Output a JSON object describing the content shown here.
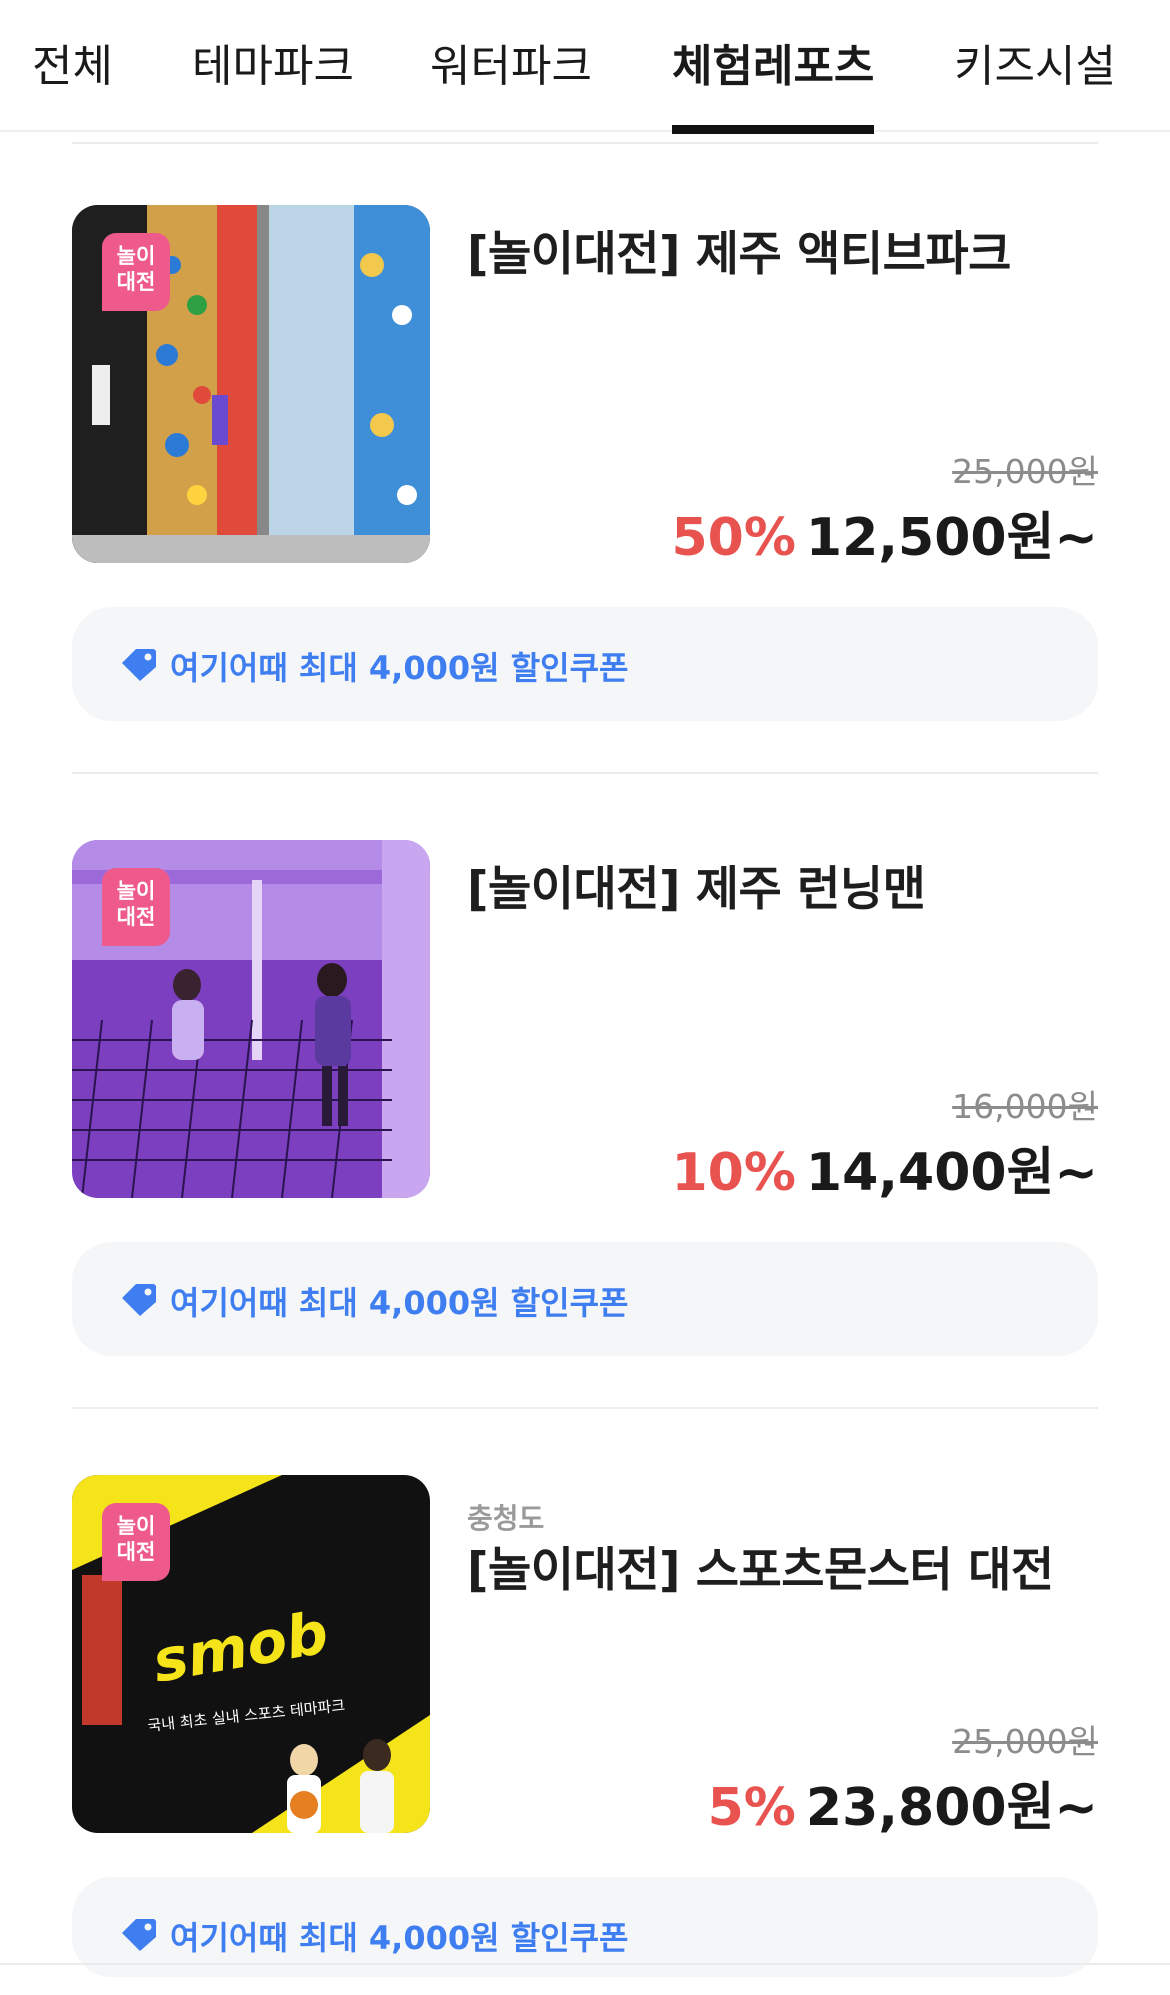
{
  "tabs": [
    {
      "label": "전체",
      "active": false
    },
    {
      "label": "테마파크",
      "active": false
    },
    {
      "label": "워터파크",
      "active": false
    },
    {
      "label": "체험레포츠",
      "active": true
    },
    {
      "label": "키즈시설",
      "active": false
    }
  ],
  "products": [
    {
      "badge": "놀이\n대전",
      "region": "",
      "title": "[놀이대전] 제주 액티브파크",
      "original_price": "25,000원",
      "discount": "50%",
      "price": "12,500원~",
      "coupon": "여기어때 최대 4,000원 할인쿠폰"
    },
    {
      "badge": "놀이\n대전",
      "region": "",
      "title": "[놀이대전] 제주 런닝맨",
      "original_price": "16,000원",
      "discount": "10%",
      "price": "14,400원~",
      "coupon": "여기어때 최대 4,000원 할인쿠폰"
    },
    {
      "badge": "놀이\n대전",
      "region": "충청도",
      "title": "[놀이대전] 스포츠몬스터 대전",
      "original_price": "25,000원",
      "discount": "5%",
      "price": "23,800원~",
      "coupon": "여기어때 최대 4,000원 할인쿠폰",
      "image_text": {
        "logo": "smob",
        "tagline": "국내 최초 실내 스포츠 테마파크"
      }
    }
  ],
  "colors": {
    "discount": "#e8524f",
    "coupon": "#3f7ef0",
    "badge": "#ee5a8b"
  }
}
